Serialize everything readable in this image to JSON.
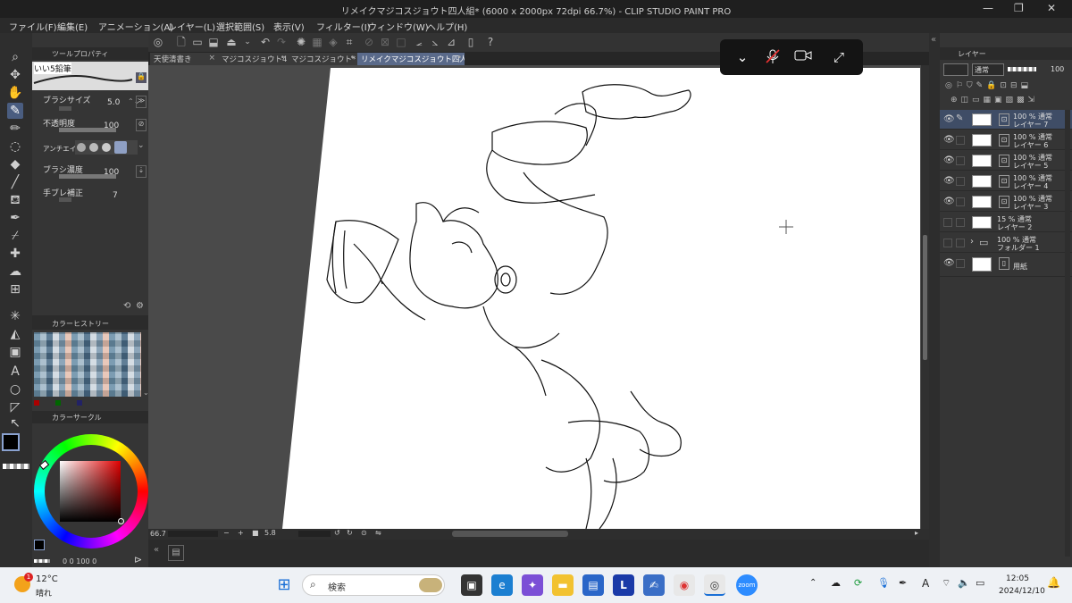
{
  "titlebar": {
    "title": "リメイクマジコスジョウト四人組* (6000 x 2000px 72dpi 66.7%)  - CLIP STUDIO PAINT PRO"
  },
  "menu": [
    "ファイル(F)",
    "編集(E)",
    "アニメーション(A)",
    "レイヤー(L)",
    "選択範囲(S)",
    "表示(V)",
    "フィルター(I)",
    "ウィンドウ(W)",
    "ヘルプ(H)"
  ],
  "tabs": [
    {
      "label": "天使清書き",
      "close": "×"
    },
    {
      "label": "マジコスジョウト4",
      "close": "•"
    },
    {
      "label": "マジコスジョウト*",
      "close": "•"
    },
    {
      "label": "リメイクマジコスジョウト四人組*",
      "close": "•"
    }
  ],
  "subtool": {
    "header": "ツールプロパティ",
    "brush_name": "いい5鉛筆",
    "props": [
      {
        "label": "ブラシサイズ",
        "value": "5.0"
      },
      {
        "label": "不透明度",
        "value": "100"
      },
      {
        "label": "アンチエイリ",
        "value": ""
      },
      {
        "label": "ブラシ濃度",
        "value": "100"
      },
      {
        "label": "手ブレ補正",
        "value": "7"
      }
    ]
  },
  "colorhistory": {
    "header": "カラーヒストリー"
  },
  "colorwheel": {
    "header": "カラーサークル",
    "hsv": "0  0 100  0"
  },
  "statusbar": {
    "zoom": "66.7",
    "angle": "5.8"
  },
  "layers": {
    "header": "レイヤー",
    "blend": "通常",
    "opacity": "100",
    "rows": [
      {
        "l1": "100 % 通常",
        "l2": "レイヤー 7",
        "selected": true,
        "visible": true
      },
      {
        "l1": "100 % 通常",
        "l2": "レイヤー 6",
        "selected": false,
        "visible": true
      },
      {
        "l1": "100 % 通常",
        "l2": "レイヤー 5",
        "selected": false,
        "visible": true
      },
      {
        "l1": "100 % 通常",
        "l2": "レイヤー 4",
        "selected": false,
        "visible": true
      },
      {
        "l1": "100 % 通常",
        "l2": "レイヤー 3",
        "selected": false,
        "visible": true
      },
      {
        "l1": "15 % 通常",
        "l2": "レイヤー 2",
        "selected": false,
        "visible": false
      },
      {
        "l1": "100 % 通常",
        "l2": "フォルダー 1",
        "selected": false,
        "visible": false
      },
      {
        "l1": "用紙",
        "l2": "",
        "selected": false,
        "visible": true
      }
    ]
  },
  "taskbar": {
    "weather_temp": "12°C",
    "weather_desc": "晴れ",
    "weather_badge": "1",
    "search_placeholder": "検索",
    "time": "12:05",
    "date": "2024/12/10",
    "ime": "A"
  },
  "colors": {
    "accent": "#4a5d80",
    "canvas": "#ffffff",
    "workspace": "#4a4a4a"
  }
}
